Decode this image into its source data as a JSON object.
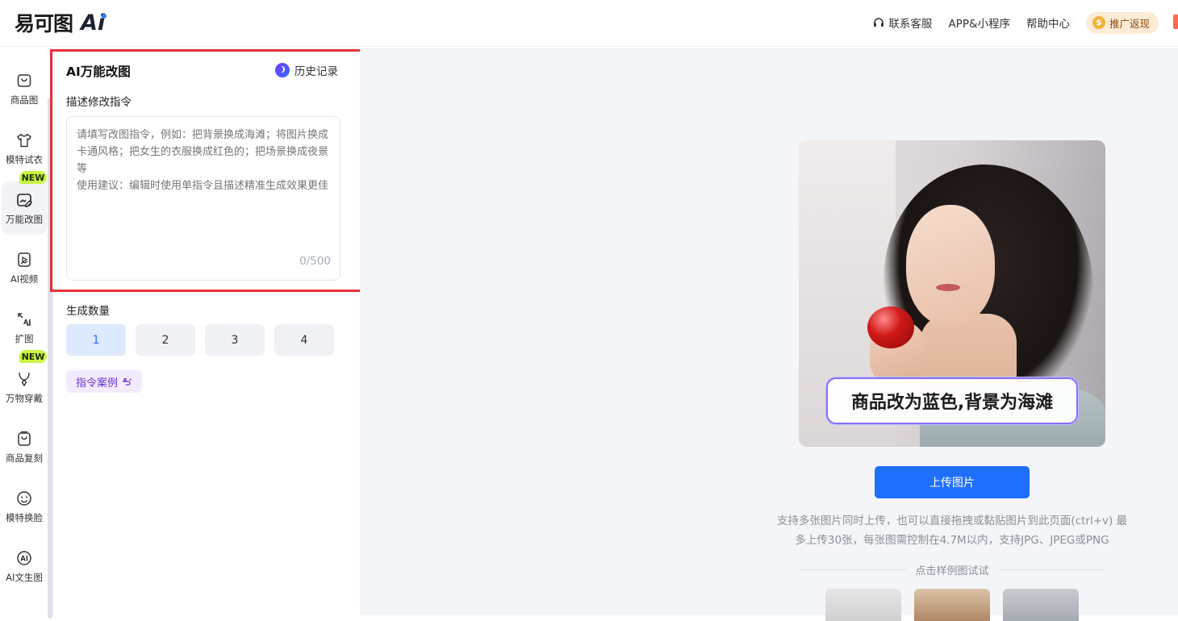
{
  "header": {
    "logo_text": "易可图",
    "logo_ai": "Ai",
    "nav": {
      "support": "联系客服",
      "app": "APP&小程序",
      "help": "帮助中心",
      "promo": "推广返现"
    }
  },
  "rail": {
    "items": [
      {
        "label": "商品图",
        "icon": "shopping-bag-icon"
      },
      {
        "label": "模特试衣",
        "icon": "tshirt-icon"
      },
      {
        "label": "万能改图",
        "icon": "image-edit-icon",
        "badge": "NEW"
      },
      {
        "label": "AI视频",
        "icon": "video-icon"
      },
      {
        "label": "扩图",
        "icon": "expand-image-icon"
      },
      {
        "label": "万物穿戴",
        "icon": "necklace-icon",
        "badge": "NEW"
      },
      {
        "label": "商品复刻",
        "icon": "bag-copy-icon"
      },
      {
        "label": "模特换脸",
        "icon": "face-icon"
      },
      {
        "label": "AI文生图",
        "icon": "ai-text-icon"
      }
    ]
  },
  "panel": {
    "title": "AI万能改图",
    "history": "历史记录",
    "prompt_label": "描述修改指令",
    "prompt_placeholder": "请填写改图指令，例如：把背景换成海滩；将图片换成卡通风格；把女生的衣服换成红色的；把场景换成夜景等\n使用建议：编辑时使用单指令且描述精准生成效果更佳",
    "counter": "0/500",
    "quantity_label": "生成数量",
    "quantities": [
      "1",
      "2",
      "3",
      "4"
    ],
    "selected_quantity": "1",
    "case_button": "指令案例"
  },
  "main": {
    "caption": "商品改为蓝色,背景为海滩",
    "upload_button": "上传图片",
    "hint_line1": "支持多张图片同时上传，也可以直接拖拽或黏贴图片到此页面(ctrl+v) 最",
    "hint_line2": "多上传30张，每张图需控制在4.7M以内，支持JPG、JPEG或PNG",
    "sample_divider": "点击样例图试试"
  },
  "colors": {
    "accent": "#1f6fff",
    "highlight_border": "#e8303a",
    "new_badge": "#c8f542",
    "case_button_text": "#6b2fd0"
  }
}
